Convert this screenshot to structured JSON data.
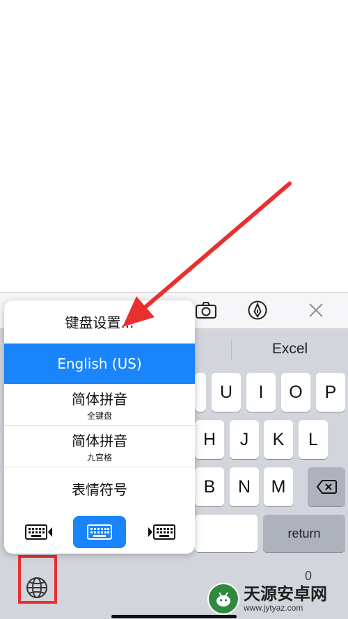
{
  "toolbar": {
    "icons": [
      "camera-icon",
      "markup-pen-icon",
      "close-icon"
    ]
  },
  "suggestions": {
    "word": "Excel"
  },
  "keyboard": {
    "row1": [
      "U",
      "I",
      "O",
      "P"
    ],
    "row2": [
      "H",
      "J",
      "K",
      "L"
    ],
    "row3": [
      "B",
      "N",
      "M"
    ],
    "return_label": "return",
    "partial_bottom_char": "0"
  },
  "language_menu": {
    "settings_label": "键盘设置...",
    "items": [
      {
        "label": "English (US)",
        "sub": "",
        "selected": true
      },
      {
        "label": "简体拼音",
        "sub": "全键盘",
        "selected": false
      },
      {
        "label": "简体拼音",
        "sub": "九宫格",
        "selected": false
      },
      {
        "label": "表情符号",
        "sub": "",
        "selected": false
      }
    ],
    "layout_options": [
      "keyboard-left-icon",
      "keyboard-full-icon",
      "keyboard-right-icon"
    ],
    "active_layout": "keyboard-full-icon"
  },
  "annotation": {
    "arrow_color": "#e8302f",
    "highlight_color": "#e8302f"
  },
  "watermark": {
    "text_cn": "天源安卓网",
    "url": "www.jytyaz.com"
  },
  "colors": {
    "accent": "#1a84fb",
    "keyboard_bg": "#d2d5db",
    "dark_key": "#adb2bc"
  }
}
